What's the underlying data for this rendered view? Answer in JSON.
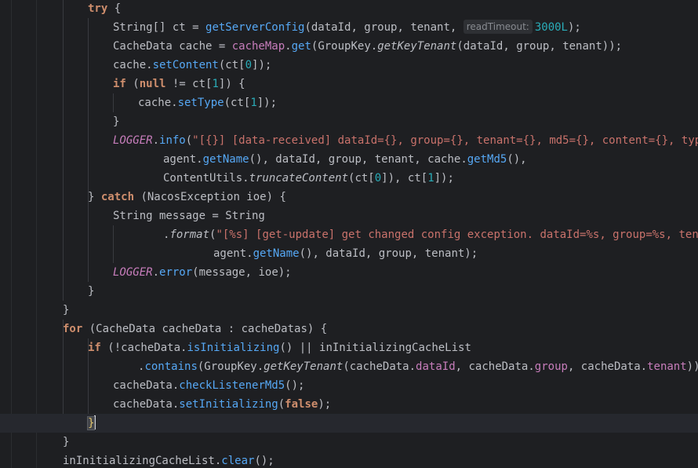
{
  "editor": {
    "lines": [
      {
        "indent": 3,
        "tokens": [
          [
            "kw",
            "try"
          ],
          [
            "p",
            " {"
          ]
        ]
      },
      {
        "indent": 4,
        "tokens": [
          [
            "p",
            "String[] ct = "
          ],
          [
            "mth",
            "getServerConfig"
          ],
          [
            "p",
            "(dataId, group, tenant, "
          ],
          [
            "hint",
            "readTimeout:"
          ],
          [
            "num",
            "3000L"
          ],
          [
            "p",
            ");"
          ]
        ]
      },
      {
        "indent": 4,
        "tokens": [
          [
            "p",
            "CacheData cache = "
          ],
          [
            "fld",
            "cacheMap"
          ],
          [
            "p",
            "."
          ],
          [
            "mth",
            "get"
          ],
          [
            "p",
            "(GroupKey."
          ],
          [
            "smth",
            "getKeyTenant"
          ],
          [
            "p",
            "(dataId, group, tenant));"
          ]
        ]
      },
      {
        "indent": 4,
        "tokens": [
          [
            "p",
            "cache."
          ],
          [
            "mth",
            "setContent"
          ],
          [
            "p",
            "(ct["
          ],
          [
            "num",
            "0"
          ],
          [
            "p",
            "]);"
          ]
        ]
      },
      {
        "indent": 4,
        "tokens": [
          [
            "kw",
            "if"
          ],
          [
            "p",
            " ("
          ],
          [
            "lit",
            "null"
          ],
          [
            "p",
            " != ct["
          ],
          [
            "num",
            "1"
          ],
          [
            "p",
            "]) {"
          ]
        ]
      },
      {
        "indent": 5,
        "tokens": [
          [
            "p",
            "cache."
          ],
          [
            "mth",
            "setType"
          ],
          [
            "p",
            "(ct["
          ],
          [
            "num",
            "1"
          ],
          [
            "p",
            "]);"
          ]
        ]
      },
      {
        "indent": 4,
        "tokens": [
          [
            "p",
            "}"
          ]
        ]
      },
      {
        "indent": 4,
        "tokens": [
          [
            "sfld",
            "LOGGER"
          ],
          [
            "p",
            "."
          ],
          [
            "mth",
            "info"
          ],
          [
            "p",
            "("
          ],
          [
            "str2",
            "\"[{}] [data-received] dataId={}, group={}, tenant={}, md5={}, content={}, type={}"
          ]
        ]
      },
      {
        "indent": 6,
        "tokens": [
          [
            "p",
            "agent."
          ],
          [
            "mth",
            "getName"
          ],
          [
            "p",
            "(), dataId, group, tenant, cache."
          ],
          [
            "mth",
            "getMd5"
          ],
          [
            "p",
            "(),"
          ]
        ]
      },
      {
        "indent": 6,
        "tokens": [
          [
            "p",
            "ContentUtils."
          ],
          [
            "smth",
            "truncateContent"
          ],
          [
            "p",
            "(ct["
          ],
          [
            "num",
            "0"
          ],
          [
            "p",
            "]), ct["
          ],
          [
            "num",
            "1"
          ],
          [
            "p",
            "]);"
          ]
        ]
      },
      {
        "indent": 3,
        "tokens": [
          [
            "p",
            "} "
          ],
          [
            "kw",
            "catch"
          ],
          [
            "p",
            " (NacosException ioe) {"
          ]
        ]
      },
      {
        "indent": 4,
        "tokens": [
          [
            "p",
            "String message = String"
          ]
        ]
      },
      {
        "indent": 6,
        "tokens": [
          [
            "p",
            "."
          ],
          [
            "smth",
            "format"
          ],
          [
            "p",
            "("
          ],
          [
            "str2",
            "\"[%s] [get-update] get changed config exception. dataId=%s, group=%s, tenant=%"
          ]
        ]
      },
      {
        "indent": 8,
        "tokens": [
          [
            "p",
            "agent."
          ],
          [
            "mth",
            "getName"
          ],
          [
            "p",
            "(), dataId, group, tenant);"
          ]
        ]
      },
      {
        "indent": 4,
        "tokens": [
          [
            "sfld",
            "LOGGER"
          ],
          [
            "p",
            "."
          ],
          [
            "mth",
            "error"
          ],
          [
            "p",
            "(message, ioe);"
          ]
        ]
      },
      {
        "indent": 3,
        "tokens": [
          [
            "p",
            "}"
          ]
        ]
      },
      {
        "indent": 2,
        "tokens": [
          [
            "p",
            "}"
          ]
        ]
      },
      {
        "indent": 2,
        "tokens": [
          [
            "kw",
            "for"
          ],
          [
            "p",
            " (CacheData cacheData : cacheDatas) {"
          ]
        ]
      },
      {
        "indent": 3,
        "tokens": [
          [
            "kw",
            "if"
          ],
          [
            "p",
            " (!cacheData."
          ],
          [
            "mth",
            "isInitializing"
          ],
          [
            "p",
            "() || inInitializingCacheList"
          ]
        ]
      },
      {
        "indent": 5,
        "tokens": [
          [
            "p",
            "."
          ],
          [
            "mth",
            "contains"
          ],
          [
            "p",
            "(GroupKey."
          ],
          [
            "smth",
            "getKeyTenant"
          ],
          [
            "p",
            "(cacheData."
          ],
          [
            "fld",
            "dataId"
          ],
          [
            "p",
            ", cacheData."
          ],
          [
            "fld",
            "group"
          ],
          [
            "p",
            ", cacheData."
          ],
          [
            "fld",
            "tenant"
          ],
          [
            "p",
            ")))"
          ],
          [
            "bh",
            " {"
          ]
        ]
      },
      {
        "indent": 4,
        "tokens": [
          [
            "p",
            "cacheData."
          ],
          [
            "mth",
            "checkListenerMd5"
          ],
          [
            "p",
            "();"
          ]
        ]
      },
      {
        "indent": 4,
        "tokens": [
          [
            "p",
            "cacheData."
          ],
          [
            "mth",
            "setInitializing"
          ],
          [
            "p",
            "("
          ],
          [
            "lit",
            "false"
          ],
          [
            "p",
            ");"
          ]
        ]
      },
      {
        "indent": 3,
        "tokens": [
          [
            "bm",
            "}"
          ],
          [
            "caret",
            ""
          ]
        ]
      },
      {
        "indent": 2,
        "tokens": [
          [
            "p",
            "}"
          ]
        ]
      },
      {
        "indent": 2,
        "tokens": [
          [
            "p",
            "inInitializingCacheList."
          ],
          [
            "mth",
            "clear"
          ],
          [
            "p",
            "();"
          ]
        ]
      }
    ],
    "current_line_index": 22,
    "first_line_top": -1
  }
}
